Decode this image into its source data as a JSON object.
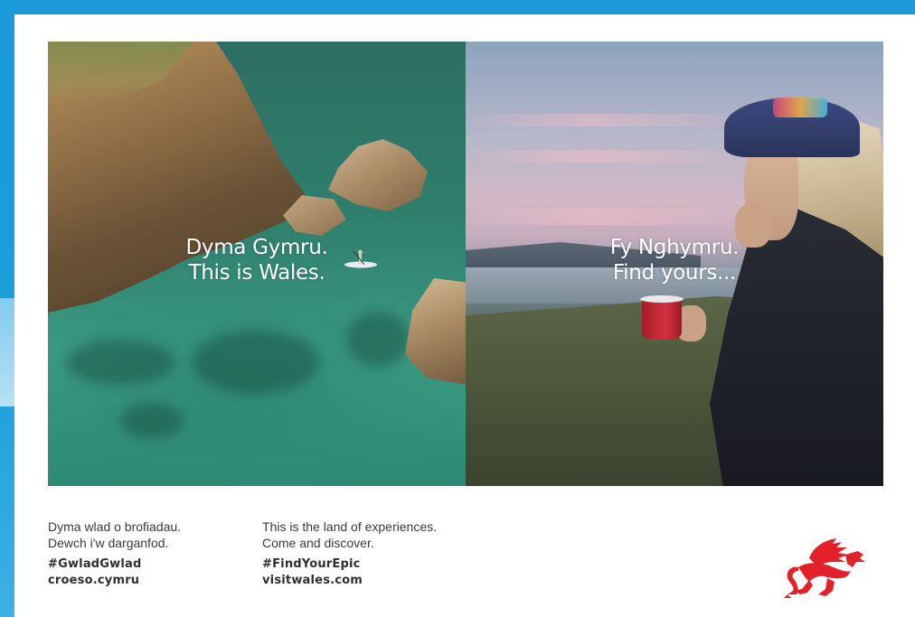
{
  "poster": {
    "left_photo_text": [
      "Dyma Gymru.",
      "This is Wales."
    ],
    "right_photo_text": [
      "Fy Nghymru.",
      "Find yours..."
    ],
    "welsh_caption": [
      "Dyma wlad o brofiadau.",
      "Dewch i'w darganfod."
    ],
    "english_caption": [
      "This is the land of experiences.",
      "Come and discover."
    ],
    "welsh_tags": [
      "#GwladGwlad",
      "croeso.cymru"
    ],
    "english_tags": [
      "#FindYourEpic",
      "visitwales.com"
    ],
    "logo_icon": "welsh-dragon-icon"
  },
  "colors": {
    "background_blue": "#1a9ad9",
    "dragon_red": "#e3212b",
    "text_dark": "#3a3a3a"
  }
}
